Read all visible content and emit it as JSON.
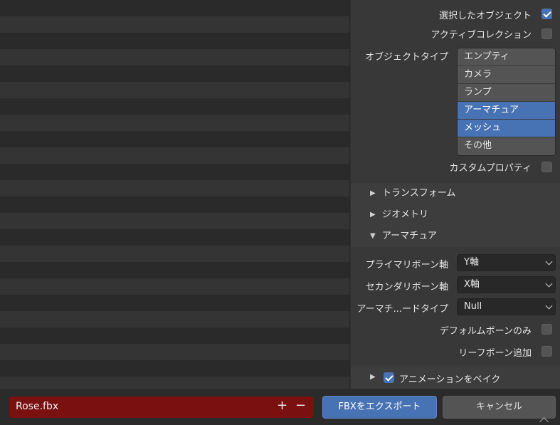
{
  "panel": {
    "selected_objects_label": "選択したオブジェクト",
    "selected_objects_checked": true,
    "active_collection_label": "アクティブコレクション",
    "active_collection_checked": false,
    "object_types_label": "オブジェクトタイプ",
    "object_types": [
      {
        "label": "エンプティ",
        "selected": false
      },
      {
        "label": "カメラ",
        "selected": false
      },
      {
        "label": "ランプ",
        "selected": false
      },
      {
        "label": "アーマチュア",
        "selected": true
      },
      {
        "label": "メッシュ",
        "selected": true
      },
      {
        "label": "その他",
        "selected": false
      }
    ],
    "custom_props_label": "カスタムプロパティ",
    "custom_props_checked": false
  },
  "sections": {
    "transform": "トランスフォーム",
    "geometry": "ジオメトリ",
    "armature": "アーマチュア"
  },
  "armature": {
    "primary_bone_axis_label": "プライマリボーン軸",
    "primary_bone_axis_value": "Y軸",
    "secondary_bone_axis_label": "セカンダリボーン軸",
    "secondary_bone_axis_value": "X軸",
    "armature_node_type_label": "アーマチ...ードタイプ",
    "armature_node_type_value": "Null",
    "deform_bones_only_label": "デフォルムボーンのみ",
    "deform_bones_only_checked": false,
    "add_leaf_bones_label": "リーフボーン追加",
    "add_leaf_bones_checked": false
  },
  "bake_animation": {
    "label": "アニメーションをベイク",
    "checked": true
  },
  "bottom": {
    "filename": "Rose.fbx",
    "plus": "+",
    "minus": "−",
    "export_label": "FBXをエクスポート",
    "cancel_label": "キャンセル"
  },
  "icons": {
    "expand": "▶",
    "collapse": "▼"
  },
  "colors": {
    "accent": "#4772b3",
    "filename_bg": "#7a1010"
  }
}
